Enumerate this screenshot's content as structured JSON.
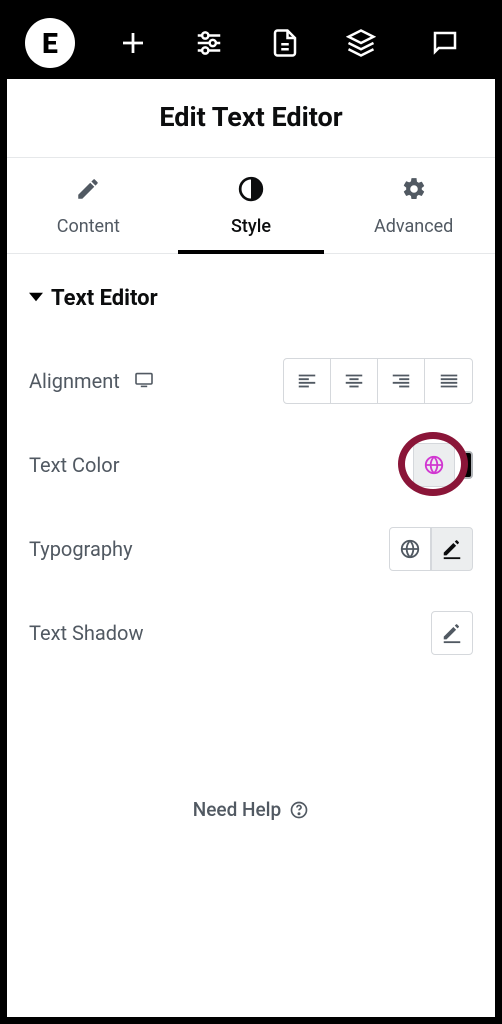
{
  "logo": "E",
  "title": "Edit Text Editor",
  "tabs": {
    "content": "Content",
    "style": "Style",
    "advanced": "Advanced"
  },
  "section": {
    "title": "Text Editor"
  },
  "controls": {
    "alignment": "Alignment",
    "textColor": "Text Color",
    "typography": "Typography",
    "textShadow": "Text Shadow"
  },
  "footer": {
    "needHelp": "Need Help"
  },
  "colors": {
    "highlight": "#8a1538",
    "globalColorIcon": "#d138d1"
  }
}
